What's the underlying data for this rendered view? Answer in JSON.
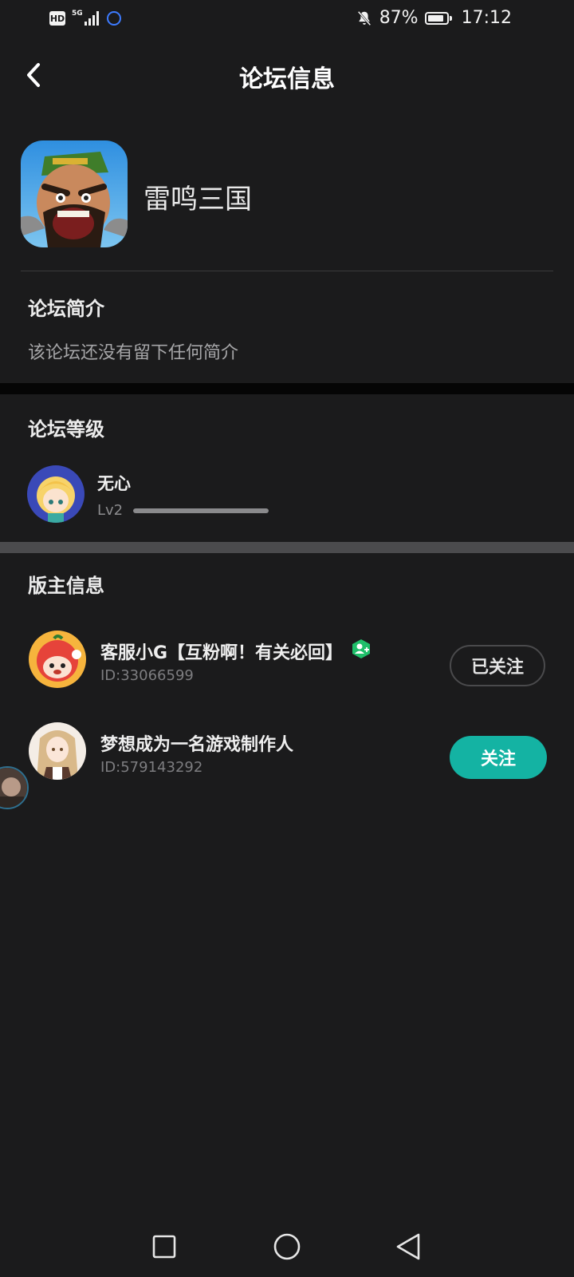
{
  "status_bar": {
    "hd": "HD",
    "network": "5G",
    "battery_percent_text": "87%",
    "battery_level": 0.87,
    "time": "17:12"
  },
  "header": {
    "title": "论坛信息"
  },
  "forum": {
    "name": "雷鸣三国"
  },
  "intro": {
    "title": "论坛简介",
    "text": "该论坛还没有留下任何简介"
  },
  "level": {
    "title": "论坛等级",
    "user_name": "无心",
    "level_label": "Lv2",
    "progress": 1.0
  },
  "moderators": {
    "title": "版主信息",
    "items": [
      {
        "name": "客服小G【互粉啊！有关必回】",
        "id": "ID:33066599",
        "button": "已关注",
        "followed": true
      },
      {
        "name": "梦想成为一名游戏制作人",
        "id": "ID:579143292",
        "button": "关注",
        "followed": false
      }
    ]
  },
  "colors": {
    "background": "#1b1b1c",
    "accent": "#14b3a3",
    "badge_green": "#1fbf6a"
  },
  "icons": {
    "back": "chevron-left-icon",
    "bell_off": "bell-off-icon",
    "moderator_badge": "user-plus-badge-icon",
    "nav_recent": "square-icon",
    "nav_home": "circle-icon",
    "nav_back": "triangle-left-icon"
  }
}
